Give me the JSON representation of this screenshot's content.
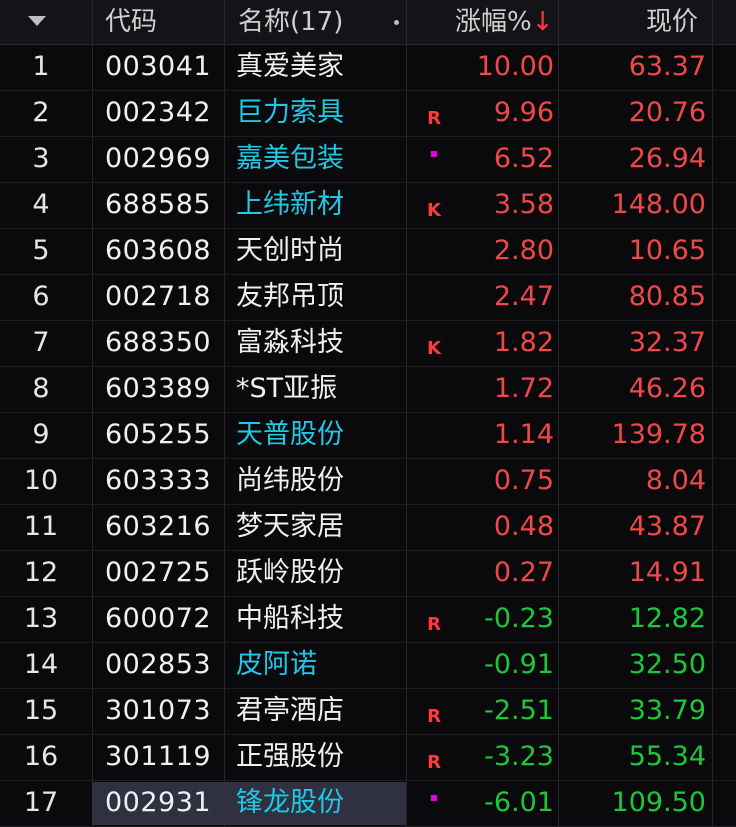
{
  "header": {
    "col_code": "代码",
    "col_name": "名称(17)",
    "col_pct": "涨幅%",
    "col_pct_sort": "↓",
    "col_price": "现价"
  },
  "colors": {
    "up": "#f04848",
    "down": "#1ec73a",
    "cyan": "#1ec8e6",
    "white": "#f0f0f0",
    "mark_red": "#ff3a3a",
    "mark_magenta": "#e600e6"
  },
  "rows": [
    {
      "idx": "1",
      "code": "003041",
      "name": "真爱美家",
      "name_color": "white",
      "mark": "",
      "mark_type": "",
      "pct": "10.00",
      "price": "63.37",
      "dir": "up"
    },
    {
      "idx": "2",
      "code": "002342",
      "name": "巨力索具",
      "name_color": "cyan",
      "mark": "R",
      "mark_type": "r",
      "pct": "9.96",
      "price": "20.76",
      "dir": "up"
    },
    {
      "idx": "3",
      "code": "002969",
      "name": "嘉美包装",
      "name_color": "cyan",
      "mark": "▪",
      "mark_type": "dot",
      "pct": "6.52",
      "price": "26.94",
      "dir": "up"
    },
    {
      "idx": "4",
      "code": "688585",
      "name": "上纬新材",
      "name_color": "cyan",
      "mark": "K",
      "mark_type": "k",
      "pct": "3.58",
      "price": "148.00",
      "dir": "up"
    },
    {
      "idx": "5",
      "code": "603608",
      "name": "天创时尚",
      "name_color": "white",
      "mark": "",
      "mark_type": "",
      "pct": "2.80",
      "price": "10.65",
      "dir": "up"
    },
    {
      "idx": "6",
      "code": "002718",
      "name": "友邦吊顶",
      "name_color": "white",
      "mark": "",
      "mark_type": "",
      "pct": "2.47",
      "price": "80.85",
      "dir": "up"
    },
    {
      "idx": "7",
      "code": "688350",
      "name": "富淼科技",
      "name_color": "white",
      "mark": "K",
      "mark_type": "k",
      "pct": "1.82",
      "price": "32.37",
      "dir": "up"
    },
    {
      "idx": "8",
      "code": "603389",
      "name": "*ST亚振",
      "name_color": "white",
      "mark": "",
      "mark_type": "",
      "pct": "1.72",
      "price": "46.26",
      "dir": "up"
    },
    {
      "idx": "9",
      "code": "605255",
      "name": "天普股份",
      "name_color": "cyan",
      "mark": "",
      "mark_type": "",
      "pct": "1.14",
      "price": "139.78",
      "dir": "up"
    },
    {
      "idx": "10",
      "code": "603333",
      "name": "尚纬股份",
      "name_color": "white",
      "mark": "",
      "mark_type": "",
      "pct": "0.75",
      "price": "8.04",
      "dir": "up"
    },
    {
      "idx": "11",
      "code": "603216",
      "name": "梦天家居",
      "name_color": "white",
      "mark": "",
      "mark_type": "",
      "pct": "0.48",
      "price": "43.87",
      "dir": "up"
    },
    {
      "idx": "12",
      "code": "002725",
      "name": "跃岭股份",
      "name_color": "white",
      "mark": "",
      "mark_type": "",
      "pct": "0.27",
      "price": "14.91",
      "dir": "up"
    },
    {
      "idx": "13",
      "code": "600072",
      "name": "中船科技",
      "name_color": "white",
      "mark": "R",
      "mark_type": "r",
      "pct": "-0.23",
      "price": "12.82",
      "dir": "down"
    },
    {
      "idx": "14",
      "code": "002853",
      "name": "皮阿诺",
      "name_color": "cyan",
      "mark": "",
      "mark_type": "",
      "pct": "-0.91",
      "price": "32.50",
      "dir": "down"
    },
    {
      "idx": "15",
      "code": "301073",
      "name": "君亭酒店",
      "name_color": "white",
      "mark": "R",
      "mark_type": "r",
      "pct": "-2.51",
      "price": "33.79",
      "dir": "down"
    },
    {
      "idx": "16",
      "code": "301119",
      "name": "正强股份",
      "name_color": "white",
      "mark": "R",
      "mark_type": "r",
      "pct": "-3.23",
      "price": "55.34",
      "dir": "down"
    },
    {
      "idx": "17",
      "code": "002931",
      "name": "锋龙股份",
      "name_color": "cyan",
      "mark": "▪",
      "mark_type": "dot",
      "pct": "-6.01",
      "price": "109.50",
      "dir": "down",
      "selected": true
    }
  ]
}
